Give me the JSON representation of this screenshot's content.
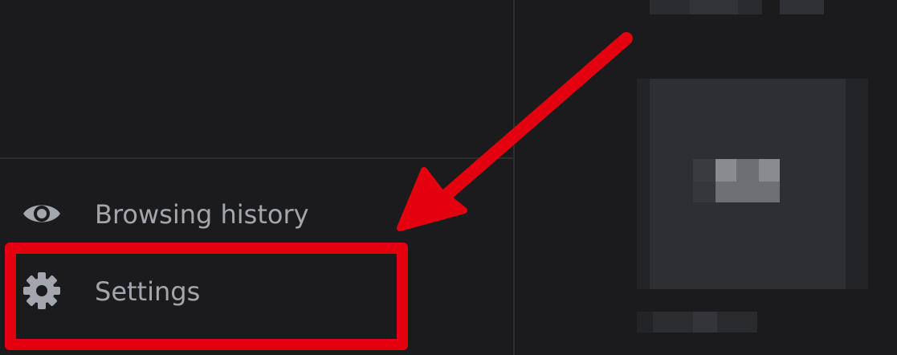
{
  "menu": {
    "items": [
      {
        "label": "Browsing history",
        "icon": "eye-icon"
      },
      {
        "label": "Settings",
        "icon": "gear-icon"
      }
    ]
  },
  "annotation": {
    "color": "#e3000f"
  },
  "colors": {
    "background": "#1b1b1d",
    "divider": "#2c2d31",
    "text": "#a3a6ad"
  }
}
